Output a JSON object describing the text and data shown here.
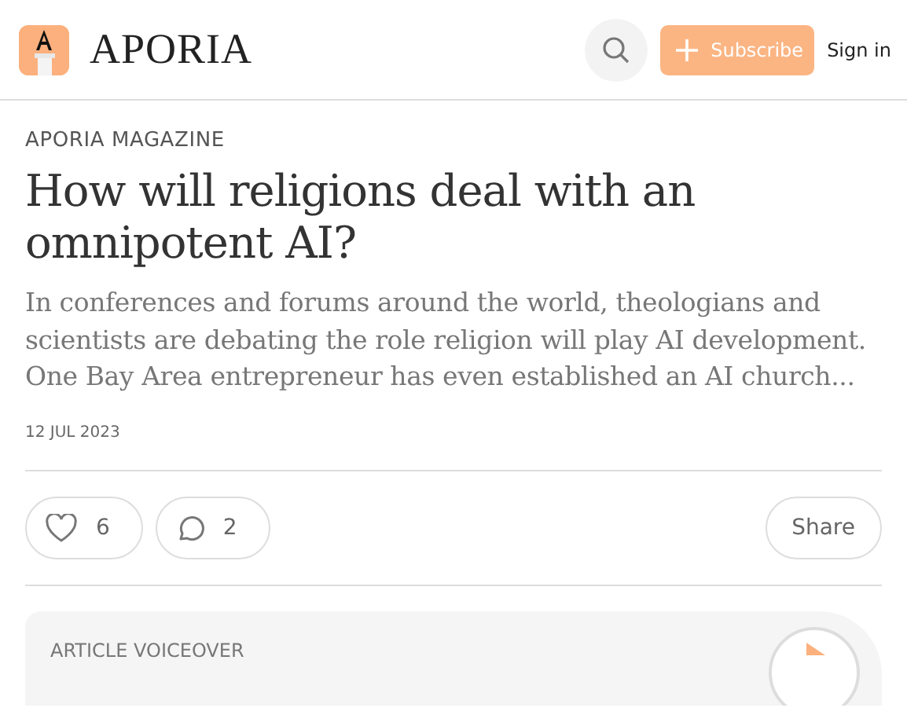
{
  "header": {
    "logo_text": "APORIA",
    "subscribe": "Subscribe",
    "sign_in": "Sign in"
  },
  "article": {
    "kicker": "APORIA MAGAZINE",
    "title": "How will religions deal with an omnipotent AI?",
    "description": "In conferences and forums around the world, theologians and scientists are debating the role religion will play AI development. One Bay Area entrepreneur has even established an AI church...",
    "date": "12 JUL 2023"
  },
  "actions": {
    "likes": "6",
    "comments": "2",
    "share": "Share"
  },
  "voiceover": {
    "label": "ARTICLE VOICEOVER"
  }
}
